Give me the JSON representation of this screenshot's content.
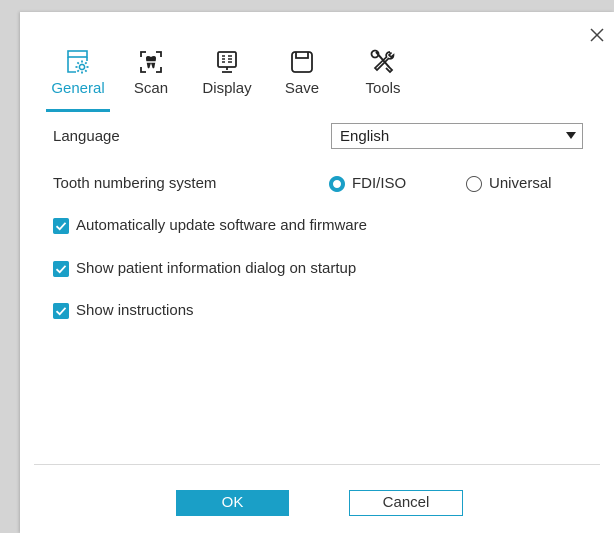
{
  "dialog": {
    "close_icon": "close-icon"
  },
  "tabs": [
    {
      "label": "General",
      "icon": "gear-window-icon",
      "active": true
    },
    {
      "label": "Scan",
      "icon": "tooth-scan-icon",
      "active": false
    },
    {
      "label": "Display",
      "icon": "monitor-icon",
      "active": false
    },
    {
      "label": "Save",
      "icon": "floppy-disk-icon",
      "active": false
    },
    {
      "label": "Tools",
      "icon": "tools-icon",
      "active": false
    }
  ],
  "general": {
    "language_label": "Language",
    "language_value": "English",
    "numbering_label": "Tooth numbering system",
    "numbering_options": [
      {
        "label": "FDI/ISO",
        "selected": true
      },
      {
        "label": "Universal",
        "selected": false
      }
    ],
    "checkboxes": [
      {
        "label": "Automatically update software and firmware",
        "checked": true
      },
      {
        "label": "Show patient information dialog on startup",
        "checked": true
      },
      {
        "label": "Show instructions",
        "checked": true
      }
    ]
  },
  "buttons": {
    "ok_label": "OK",
    "cancel_label": "Cancel"
  },
  "colors": {
    "accent": "#1a9fc7",
    "backdrop": "#d4d4d4"
  }
}
